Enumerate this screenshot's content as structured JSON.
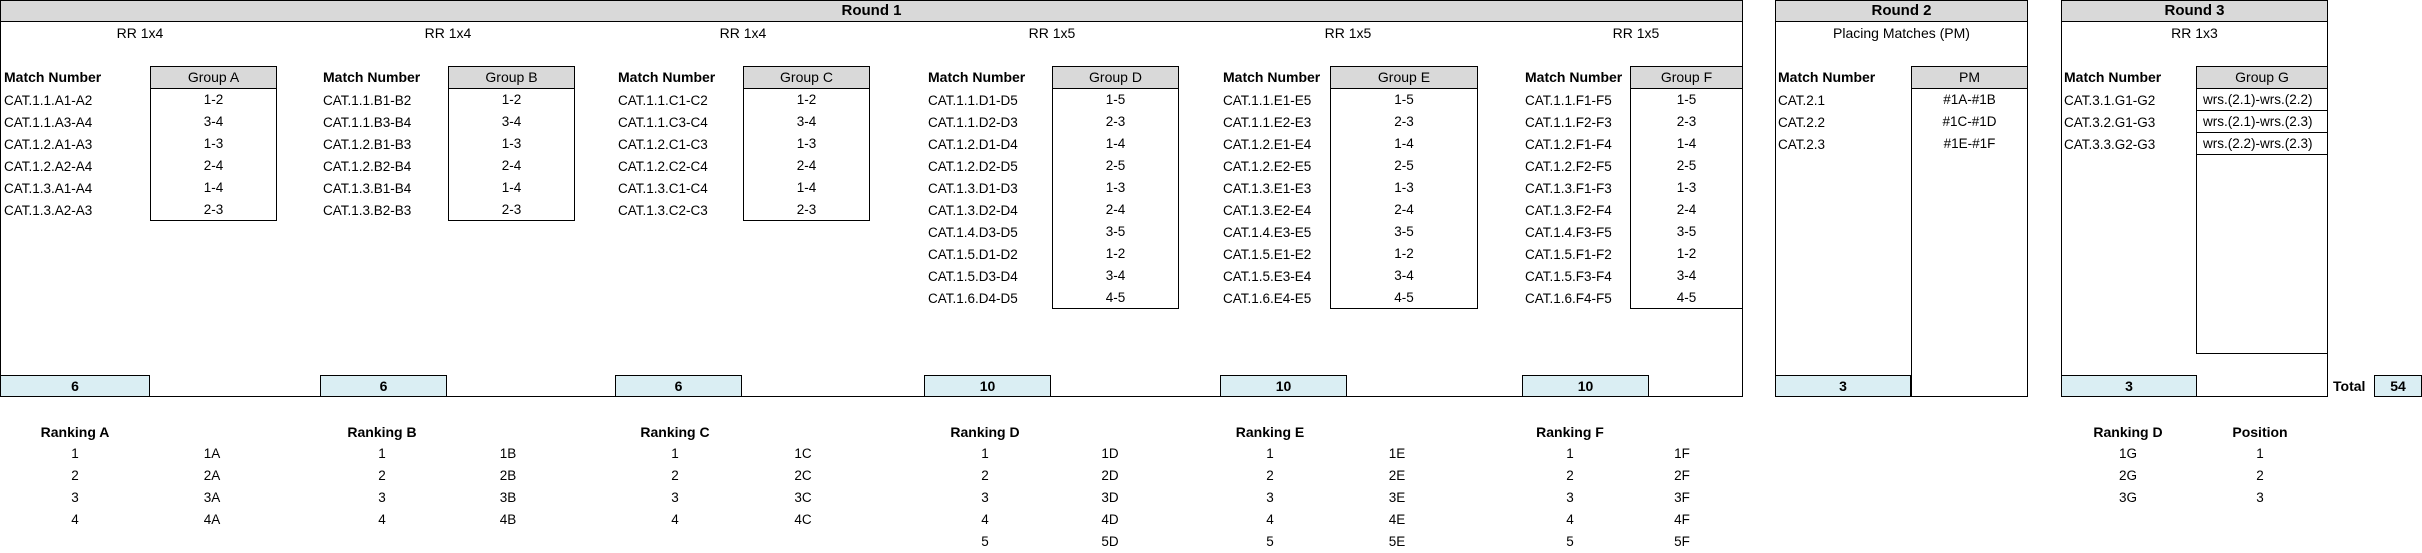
{
  "round1": {
    "title": "Round 1",
    "match_number_label": "Match Number",
    "groups": [
      {
        "format": "RR 1x4",
        "group_label": "Group A",
        "matches": [
          "CAT.1.1.A1-A2",
          "CAT.1.1.A3-A4",
          "CAT.1.2.A1-A3",
          "CAT.1.2.A2-A4",
          "CAT.1.3.A1-A4",
          "CAT.1.3.A2-A3"
        ],
        "pairings": [
          "1-2",
          "3-4",
          "1-3",
          "2-4",
          "1-4",
          "2-3"
        ],
        "count": "6"
      },
      {
        "format": "RR 1x4",
        "group_label": "Group B",
        "matches": [
          "CAT.1.1.B1-B2",
          "CAT.1.1.B3-B4",
          "CAT.1.2.B1-B3",
          "CAT.1.2.B2-B4",
          "CAT.1.3.B1-B4",
          "CAT.1.3.B2-B3"
        ],
        "pairings": [
          "1-2",
          "3-4",
          "1-3",
          "2-4",
          "1-4",
          "2-3"
        ],
        "count": "6"
      },
      {
        "format": "RR 1x4",
        "group_label": "Group C",
        "matches": [
          "CAT.1.1.C1-C2",
          "CAT.1.1.C3-C4",
          "CAT.1.2.C1-C3",
          "CAT.1.2.C2-C4",
          "CAT.1.3.C1-C4",
          "CAT.1.3.C2-C3"
        ],
        "pairings": [
          "1-2",
          "3-4",
          "1-3",
          "2-4",
          "1-4",
          "2-3"
        ],
        "count": "6"
      },
      {
        "format": "RR 1x5",
        "group_label": "Group D",
        "matches": [
          "CAT.1.1.D1-D5",
          "CAT.1.1.D2-D3",
          "CAT.1.2.D1-D4",
          "CAT.1.2.D2-D5",
          "CAT.1.3.D1-D3",
          "CAT.1.3.D2-D4",
          "CAT.1.4.D3-D5",
          "CAT.1.5.D1-D2",
          "CAT.1.5.D3-D4",
          "CAT.1.6.D4-D5"
        ],
        "pairings": [
          "1-5",
          "2-3",
          "1-4",
          "2-5",
          "1-3",
          "2-4",
          "3-5",
          "1-2",
          "3-4",
          "4-5"
        ],
        "count": "10"
      },
      {
        "format": "RR 1x5",
        "group_label": "Group E",
        "matches": [
          "CAT.1.1.E1-E5",
          "CAT.1.1.E2-E3",
          "CAT.1.2.E1-E4",
          "CAT.1.2.E2-E5",
          "CAT.1.3.E1-E3",
          "CAT.1.3.E2-E4",
          "CAT.1.4.E3-E5",
          "CAT.1.5.E1-E2",
          "CAT.1.5.E3-E4",
          "CAT.1.6.E4-E5"
        ],
        "pairings": [
          "1-5",
          "2-3",
          "1-4",
          "2-5",
          "1-3",
          "2-4",
          "3-5",
          "1-2",
          "3-4",
          "4-5"
        ],
        "count": "10"
      },
      {
        "format": "RR 1x5",
        "group_label": "Group F",
        "matches": [
          "CAT.1.1.F1-F5",
          "CAT.1.1.F2-F3",
          "CAT.1.2.F1-F4",
          "CAT.1.2.F2-F5",
          "CAT.1.3.F1-F3",
          "CAT.1.3.F2-F4",
          "CAT.1.4.F3-F5",
          "CAT.1.5.F1-F2",
          "CAT.1.5.F3-F4",
          "CAT.1.6.F4-F5"
        ],
        "pairings": [
          "1-5",
          "2-3",
          "1-4",
          "2-5",
          "1-3",
          "2-4",
          "3-5",
          "1-2",
          "3-4",
          "4-5"
        ],
        "count": "10"
      }
    ]
  },
  "round2": {
    "title": "Round 2",
    "subtitle": "Placing Matches (PM)",
    "match_number_label": "Match Number",
    "group_label": "PM",
    "matches": [
      "CAT.2.1",
      "CAT.2.2",
      "CAT.2.3"
    ],
    "pairings": [
      "#1A-#1B",
      "#1C-#1D",
      "#1E-#1F"
    ],
    "count": "3"
  },
  "round3": {
    "title": "Round 3",
    "format": "RR 1x3",
    "match_number_label": "Match Number",
    "group_label": "Group G",
    "matches": [
      "CAT.3.1.G1-G2",
      "CAT.3.2.G1-G3",
      "CAT.3.3.G2-G3"
    ],
    "pairings": [
      "wrs.(2.1)-wrs.(2.2)",
      "wrs.(2.1)-wrs.(2.3)",
      "wrs.(2.2)-wrs.(2.3)"
    ],
    "count": "3"
  },
  "total": {
    "label": "Total",
    "value": "54"
  },
  "rankings": [
    {
      "title": "Ranking A",
      "positions": [
        "1",
        "2",
        "3",
        "4"
      ],
      "codes": [
        "1A",
        "2A",
        "3A",
        "4A"
      ]
    },
    {
      "title": "Ranking B",
      "positions": [
        "1",
        "2",
        "3",
        "4"
      ],
      "codes": [
        "1B",
        "2B",
        "3B",
        "4B"
      ]
    },
    {
      "title": "Ranking C",
      "positions": [
        "1",
        "2",
        "3",
        "4"
      ],
      "codes": [
        "1C",
        "2C",
        "3C",
        "4C"
      ]
    },
    {
      "title": "Ranking D",
      "positions": [
        "1",
        "2",
        "3",
        "4",
        "5"
      ],
      "codes": [
        "1D",
        "2D",
        "3D",
        "4D",
        "5D"
      ]
    },
    {
      "title": "Ranking E",
      "positions": [
        "1",
        "2",
        "3",
        "4",
        "5"
      ],
      "codes": [
        "1E",
        "2E",
        "3E",
        "4E",
        "5E"
      ]
    },
    {
      "title": "Ranking F",
      "positions": [
        "1",
        "2",
        "3",
        "4",
        "5"
      ],
      "codes": [
        "1F",
        "2F",
        "3F",
        "4F",
        "5F"
      ]
    }
  ],
  "final_ranking": {
    "title": "Ranking D",
    "position_label": "Position",
    "codes": [
      "1G",
      "2G",
      "3G"
    ],
    "positions": [
      "1",
      "2",
      "3"
    ]
  }
}
